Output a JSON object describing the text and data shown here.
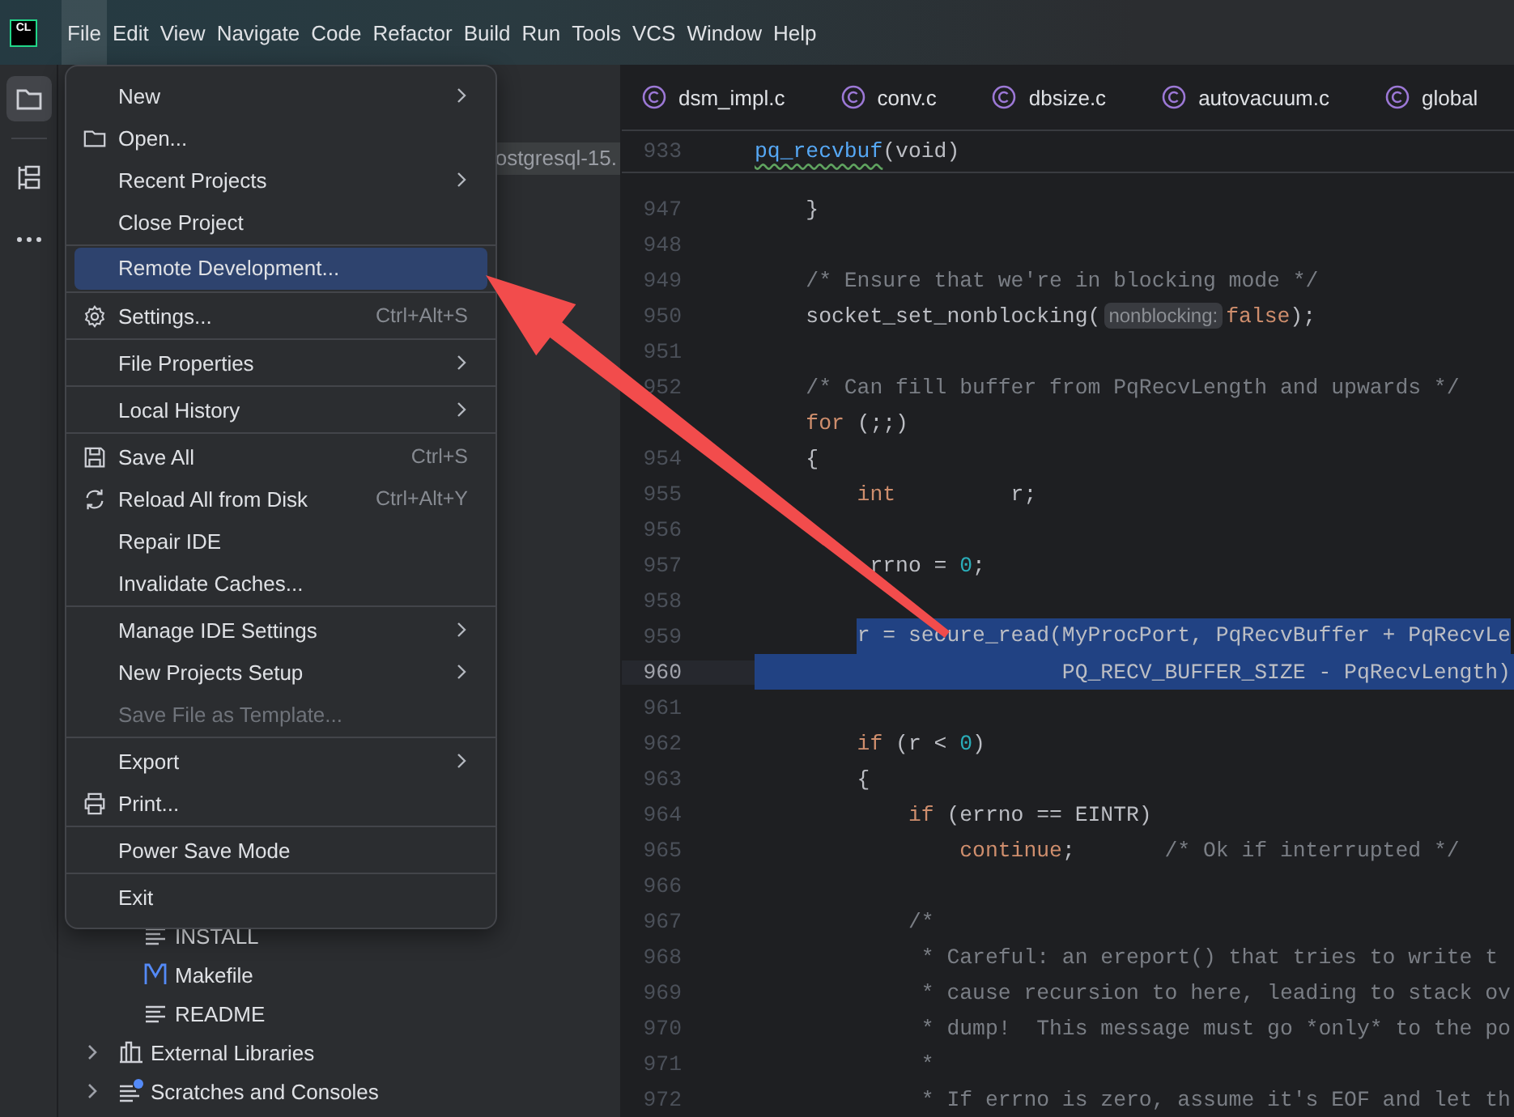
{
  "menu_bar": [
    {
      "label": "File",
      "selected": true
    },
    {
      "label": "Edit",
      "selected": false
    },
    {
      "label": "View",
      "selected": false
    },
    {
      "label": "Navigate",
      "selected": false
    },
    {
      "label": "Code",
      "selected": false
    },
    {
      "label": "Refactor",
      "selected": false
    },
    {
      "label": "Build",
      "selected": false
    },
    {
      "label": "Run",
      "selected": false
    },
    {
      "label": "Tools",
      "selected": false
    },
    {
      "label": "VCS",
      "selected": false
    },
    {
      "label": "Window",
      "selected": false
    },
    {
      "label": "Help",
      "selected": false
    }
  ],
  "logo": "CL",
  "tool_strip": [
    {
      "kind": "folder",
      "selected": true
    },
    {
      "kind": "structure",
      "selected": false
    },
    {
      "kind": "more",
      "selected": false
    }
  ],
  "project": {
    "breadcrumb": "ostgresql-15.",
    "files": [
      {
        "label": "INSTALL",
        "kind": "text"
      },
      {
        "label": "Makefile",
        "kind": "make"
      },
      {
        "label": "README",
        "kind": "text"
      }
    ],
    "roots": [
      {
        "label": "External Libraries",
        "kind": "libraries",
        "expanded": false
      },
      {
        "label": "Scratches and Consoles",
        "kind": "scratches",
        "expanded": false
      }
    ]
  },
  "file_menu": [
    {
      "kind": "item",
      "label": "New",
      "submenu": true
    },
    {
      "kind": "folder",
      "label": "Open..."
    },
    {
      "kind": "item",
      "label": "Recent Projects",
      "submenu": true
    },
    {
      "kind": "item",
      "label": "Close Project"
    },
    {
      "kind": "separator"
    },
    {
      "kind": "item",
      "label": "Remote Development...",
      "selected": true
    },
    {
      "kind": "separator"
    },
    {
      "kind": "gear",
      "label": "Settings...",
      "shortcut": "Ctrl+Alt+S"
    },
    {
      "kind": "separator"
    },
    {
      "kind": "item",
      "label": "File Properties",
      "submenu": true
    },
    {
      "kind": "separator"
    },
    {
      "kind": "item",
      "label": "Local History",
      "submenu": true
    },
    {
      "kind": "separator"
    },
    {
      "kind": "save",
      "label": "Save All",
      "shortcut": "Ctrl+S"
    },
    {
      "kind": "reload",
      "label": "Reload All from Disk",
      "shortcut": "Ctrl+Alt+Y"
    },
    {
      "kind": "item",
      "label": "Repair IDE"
    },
    {
      "kind": "item",
      "label": "Invalidate Caches..."
    },
    {
      "kind": "separator"
    },
    {
      "kind": "item",
      "label": "Manage IDE Settings",
      "submenu": true
    },
    {
      "kind": "item",
      "label": "New Projects Setup",
      "submenu": true
    },
    {
      "kind": "item",
      "label": "Save File as Template...",
      "disabled": true
    },
    {
      "kind": "separator"
    },
    {
      "kind": "item",
      "label": "Export",
      "submenu": true
    },
    {
      "kind": "printer",
      "label": "Print..."
    },
    {
      "kind": "separator"
    },
    {
      "kind": "item",
      "label": "Power Save Mode"
    },
    {
      "kind": "separator"
    },
    {
      "kind": "item",
      "label": "Exit"
    }
  ],
  "editor": {
    "tabs": [
      {
        "label": "dsm_impl.c",
        "selected": false
      },
      {
        "label": "conv.c",
        "selected": false
      },
      {
        "label": "dbsize.c",
        "selected": false
      },
      {
        "label": "autovacuum.c",
        "selected": false
      },
      {
        "label": "global",
        "selected": false
      }
    ],
    "sticky_line": {
      "number": "933",
      "tokens": [
        {
          "kind": "func",
          "text": "pq_recvbuf"
        },
        {
          "kind": "plain",
          "text": "(void)"
        }
      ]
    },
    "lines": [
      {
        "number": "947",
        "tokens": [
          {
            "kind": "plain",
            "text": "    }"
          }
        ]
      },
      {
        "number": "948"
      },
      {
        "number": "949",
        "tokens": [
          {
            "kind": "comment",
            "text": "    /* Ensure that we're in blocking mode */"
          }
        ]
      },
      {
        "number": "950",
        "tokens": [
          {
            "kind": "plain",
            "text": "    socket_set_nonblocking("
          },
          {
            "kind": "hint",
            "text": "nonblocking:"
          },
          {
            "kind": "keyword",
            "text": "false"
          },
          {
            "kind": "plain",
            "text": ");"
          }
        ]
      },
      {
        "number": "951"
      },
      {
        "number": "952",
        "tokens": [
          {
            "kind": "comment",
            "text": "    /* Can fill buffer from PqRecvLength and upwards */"
          }
        ]
      },
      {
        "tokens": [
          {
            "kind": "keyword",
            "text": "    for"
          },
          {
            "kind": "plain",
            "text": " (;;)"
          }
        ]
      },
      {
        "number": "954",
        "tokens": [
          {
            "kind": "plain",
            "text": "    {"
          }
        ]
      },
      {
        "number": "955",
        "tokens": [
          {
            "kind": "keyword",
            "text": "        int"
          },
          {
            "kind": "plain",
            "text": "         r;"
          }
        ]
      },
      {
        "number": "956"
      },
      {
        "number": "957",
        "tokens": [
          {
            "kind": "plain",
            "text": "         rrno = "
          },
          {
            "kind": "number",
            "text": "0"
          },
          {
            "kind": "plain",
            "text": ";"
          }
        ]
      },
      {
        "number": "958"
      },
      {
        "number": "959",
        "selected": true,
        "current": false,
        "tokens": [
          {
            "kind": "plain",
            "text": "        r = secure_read(MyProcPort, PqRecvBuffer + PqRecvLe"
          }
        ]
      },
      {
        "number": "960",
        "selected": true,
        "current": true,
        "tokens": [
          {
            "kind": "plain",
            "text": "                        PQ_RECV_BUFFER_SIZE - PqRecvLength)"
          }
        ]
      },
      {
        "number": "961"
      },
      {
        "number": "962",
        "tokens": [
          {
            "kind": "keyword",
            "text": "        if"
          },
          {
            "kind": "plain",
            "text": " (r < "
          },
          {
            "kind": "number",
            "text": "0"
          },
          {
            "kind": "plain",
            "text": ")"
          }
        ]
      },
      {
        "number": "963",
        "tokens": [
          {
            "kind": "plain",
            "text": "        {"
          }
        ]
      },
      {
        "number": "964",
        "tokens": [
          {
            "kind": "keyword",
            "text": "            if"
          },
          {
            "kind": "plain",
            "text": " (errno == EINTR)"
          }
        ]
      },
      {
        "number": "965",
        "tokens": [
          {
            "kind": "keyword",
            "text": "                continue"
          },
          {
            "kind": "plain",
            "text": ";"
          },
          {
            "kind": "comment",
            "text": "       /* Ok if interrupted */"
          }
        ]
      },
      {
        "number": "966"
      },
      {
        "number": "967",
        "tokens": [
          {
            "kind": "comment",
            "text": "            /*"
          }
        ]
      },
      {
        "number": "968",
        "tokens": [
          {
            "kind": "comment",
            "text": "             * Careful: an ereport() that tries to write t"
          }
        ]
      },
      {
        "number": "969",
        "tokens": [
          {
            "kind": "comment",
            "text": "             * cause recursion to here, leading to stack ov"
          }
        ]
      },
      {
        "number": "970",
        "tokens": [
          {
            "kind": "comment",
            "text": "             * dump!  This message must go *only* to the po"
          }
        ]
      },
      {
        "number": "971",
        "tokens": [
          {
            "kind": "comment",
            "text": "             *"
          }
        ]
      },
      {
        "number": "972",
        "tokens": [
          {
            "kind": "comment",
            "text": "             * If errno is zero, assume it's EOF and let th"
          }
        ]
      }
    ]
  }
}
